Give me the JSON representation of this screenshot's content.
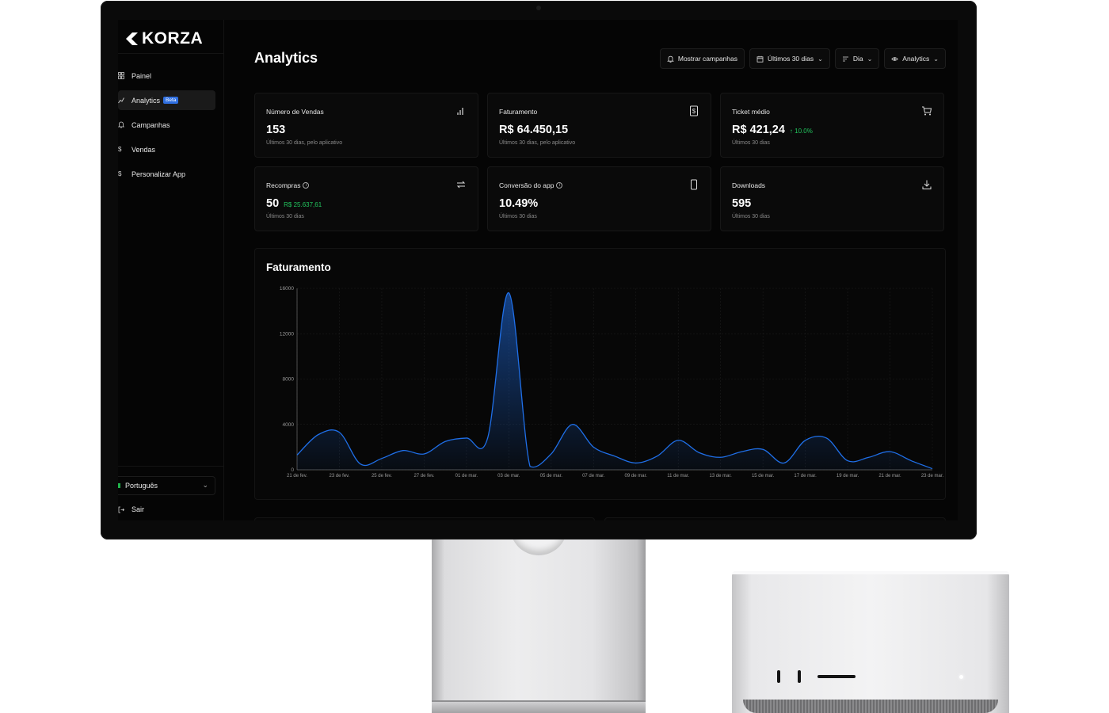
{
  "app": {
    "brand": "KORZA",
    "page_title": "Analytics"
  },
  "sidebar": {
    "items": [
      {
        "label": "Painel",
        "icon": "dashboard-icon"
      },
      {
        "label": "Analytics",
        "icon": "analytics-icon",
        "badge": "Beta",
        "active": true
      },
      {
        "label": "Campanhas",
        "icon": "bell-icon"
      },
      {
        "label": "Vendas",
        "icon": "dollar-icon"
      },
      {
        "label": "Personalizar App",
        "icon": "customize-icon"
      }
    ],
    "language": "Português",
    "logout": "Sair"
  },
  "toolbar": {
    "campaigns_label": "Mostrar campanhas",
    "range_label": "Últimos 30 dias",
    "granularity_label": "Dia",
    "view_label": "Analytics"
  },
  "metrics": [
    {
      "title": "Número de Vendas",
      "value": "153",
      "sub": "Últimos 30 dias, pelo aplicativo",
      "icon": "bar-chart-icon"
    },
    {
      "title": "Faturamento",
      "value": "R$ 64.450,15",
      "sub": "Últimos 30 dias, pelo aplicativo",
      "icon": "receipt-dollar-icon"
    },
    {
      "title": "Ticket médio",
      "value": "R$ 421,24",
      "delta": "10.0%",
      "sub": "Últimos 30 dias",
      "icon": "cart-icon"
    },
    {
      "title": "Recompras",
      "value": "50",
      "extra": "R$ 25.637,61",
      "sub": "Últimos 30 dias",
      "icon": "repeat-icon"
    },
    {
      "title": "Conversão do app",
      "value": "10.49%",
      "sub": "Últimos 30 dias",
      "icon": "phone-icon"
    },
    {
      "title": "Downloads",
      "value": "595",
      "sub": "Últimos 30 dias",
      "icon": "download-icon"
    }
  ],
  "colors": {
    "accent": "#2f6fe0",
    "line": "#1f6fe8",
    "positive": "#22c55e"
  },
  "chart_data": {
    "type": "area",
    "title": "Faturamento",
    "xlabel": "",
    "ylabel": "",
    "ylim": [
      0,
      16000
    ],
    "yticks": [
      0,
      4000,
      8000,
      12000,
      16000
    ],
    "x": [
      "21 de fev.",
      "22 de fev.",
      "23 de fev.",
      "24 de fev.",
      "25 de fev.",
      "26 de fev.",
      "27 de fev.",
      "28 de fev.",
      "01 de mar.",
      "02 de mar.",
      "03 de mar.",
      "04 de mar.",
      "05 de mar.",
      "06 de mar.",
      "07 de mar.",
      "08 de mar.",
      "09 de mar.",
      "10 de mar.",
      "11 de mar.",
      "12 de mar.",
      "13 de mar.",
      "14 de mar.",
      "15 de mar.",
      "16 de mar.",
      "17 de mar.",
      "18 de mar.",
      "19 de mar.",
      "20 de mar.",
      "21 de mar.",
      "22 de mar.",
      "23 de mar."
    ],
    "xticks": [
      "21 de fev.",
      "23 de fev.",
      "25 de fev.",
      "27 de fev.",
      "01 de mar.",
      "03 de mar.",
      "05 de mar.",
      "07 de mar.",
      "09 de mar.",
      "11 de mar.",
      "13 de mar.",
      "15 de mar.",
      "17 de mar.",
      "19 de mar.",
      "21 de mar.",
      "23 de mar."
    ],
    "series": [
      {
        "values": [
          1300,
          3100,
          3300,
          500,
          1000,
          1700,
          1400,
          2500,
          2800,
          2800,
          15600,
          300,
          1400,
          4000,
          2000,
          1200,
          600,
          1200,
          2600,
          1500,
          1100,
          1600,
          1800,
          600,
          2600,
          2800,
          800,
          1100,
          1600,
          800,
          100
        ]
      }
    ],
    "grid": true
  }
}
